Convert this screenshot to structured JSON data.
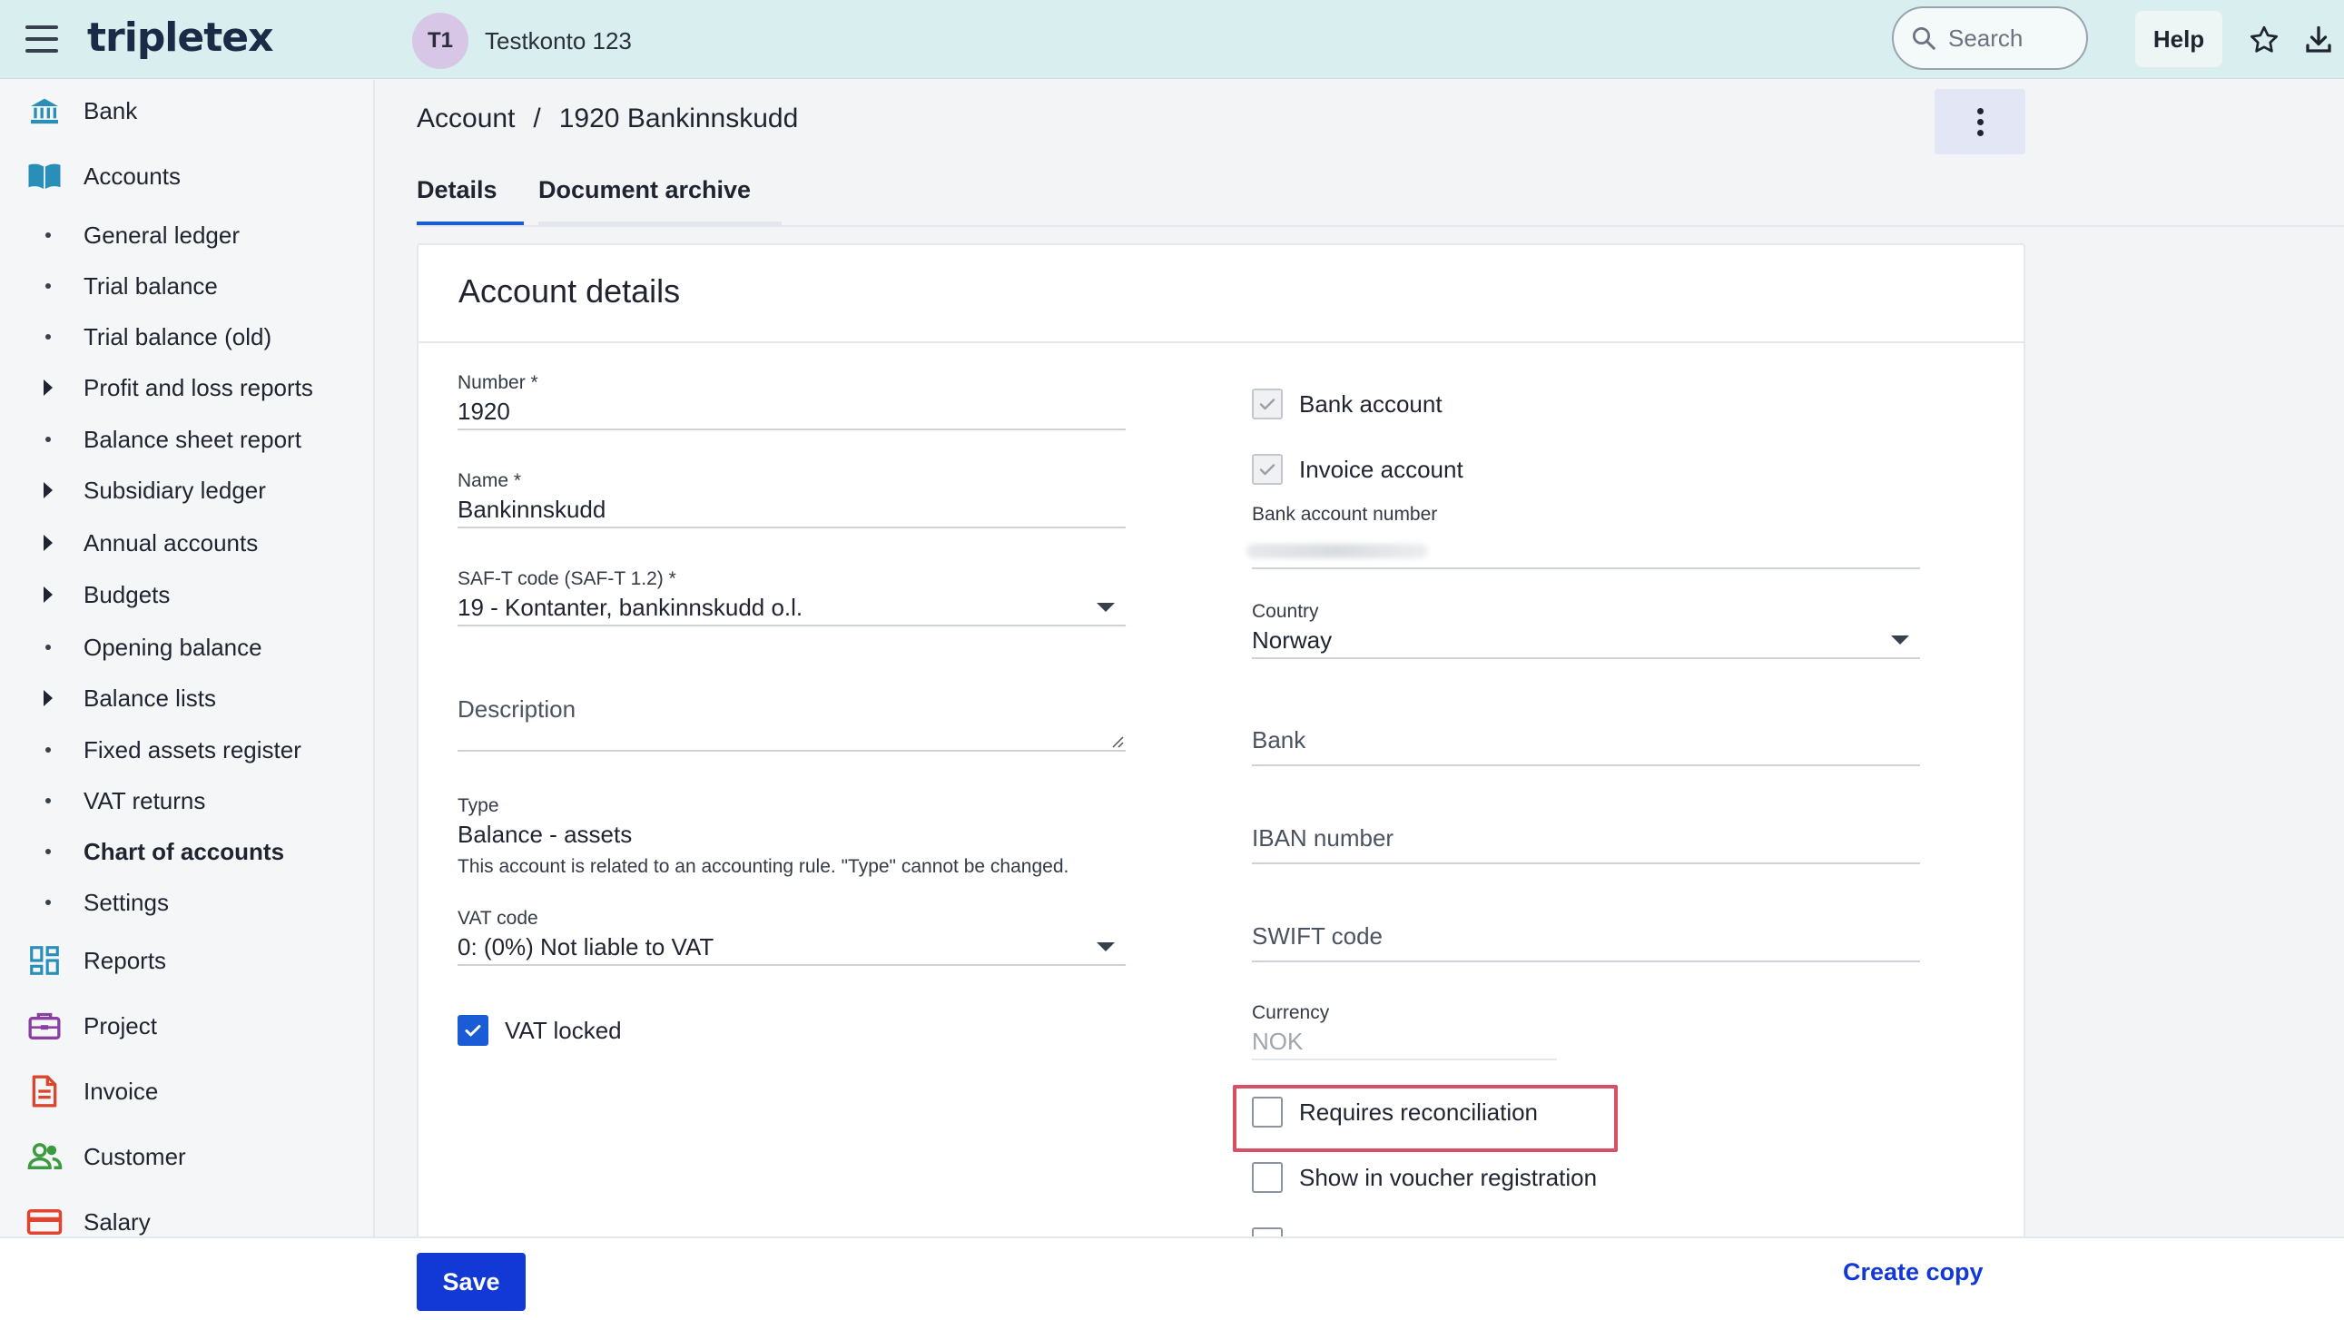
{
  "header": {
    "logo": "tripletex",
    "company_initials": "T1",
    "company_name": "Testkonto 123",
    "search_placeholder": "Search",
    "help_label": "Help"
  },
  "sidebar": {
    "items": [
      {
        "label": "Bank",
        "icon": "bank-icon"
      },
      {
        "label": "Accounts",
        "icon": "book-icon"
      }
    ],
    "sub_items": [
      {
        "label": "General ledger",
        "type": "bullet"
      },
      {
        "label": "Trial balance",
        "type": "bullet"
      },
      {
        "label": "Trial balance (old)",
        "type": "bullet"
      },
      {
        "label": "Profit and loss reports",
        "type": "caret"
      },
      {
        "label": "Balance sheet report",
        "type": "bullet"
      },
      {
        "label": "Subsidiary ledger",
        "type": "caret"
      },
      {
        "label": "Annual accounts",
        "type": "caret"
      },
      {
        "label": "Budgets",
        "type": "caret"
      },
      {
        "label": "Opening balance",
        "type": "bullet"
      },
      {
        "label": "Balance lists",
        "type": "caret"
      },
      {
        "label": "Fixed assets register",
        "type": "bullet"
      },
      {
        "label": "VAT returns",
        "type": "bullet"
      },
      {
        "label": "Chart of accounts",
        "type": "bullet",
        "active": true
      },
      {
        "label": "Settings",
        "type": "bullet"
      }
    ],
    "bottom_items": [
      {
        "label": "Reports",
        "icon": "dashboard-icon"
      },
      {
        "label": "Project",
        "icon": "briefcase-icon"
      },
      {
        "label": "Invoice",
        "icon": "document-icon"
      },
      {
        "label": "Customer",
        "icon": "people-icon"
      },
      {
        "label": "Salary",
        "icon": "card-icon"
      }
    ]
  },
  "breadcrumb": {
    "parent": "Account",
    "separator": "/",
    "current": "1920 Bankinnskudd"
  },
  "tabs": [
    {
      "label": "Details",
      "active": true
    },
    {
      "label": "Document archive",
      "active": false
    }
  ],
  "card": {
    "title": "Account details",
    "left": {
      "number_label": "Number *",
      "number_value": "1920",
      "name_label": "Name *",
      "name_value": "Bankinnskudd",
      "saft_label": "SAF-T code (SAF-T 1.2) *",
      "saft_value": "19 - Kontanter, bankinnskudd o.l.",
      "description_label": "Description",
      "type_label": "Type",
      "type_value": "Balance - assets",
      "type_note": "This account is related to an accounting rule. \"Type\" cannot be changed.",
      "vat_label": "VAT code",
      "vat_value": "0: (0%) Not liable to VAT",
      "vat_locked_label": "VAT locked",
      "vat_locked_checked": true
    },
    "right": {
      "bank_account_label": "Bank account",
      "invoice_account_label": "Invoice account",
      "bank_account_number_label": "Bank account number",
      "country_label": "Country",
      "country_value": "Norway",
      "bank_label": "Bank",
      "iban_label": "IBAN number",
      "swift_label": "SWIFT code",
      "currency_label": "Currency",
      "currency_value": "NOK",
      "requires_reconciliation_label": "Requires reconciliation",
      "show_in_voucher_label": "Show in voucher registration"
    }
  },
  "footer": {
    "save_label": "Save",
    "create_copy_label": "Create copy"
  },
  "colors": {
    "topbar": "#d9eeee",
    "primary": "#1239d6",
    "highlight": "#d94f63"
  }
}
